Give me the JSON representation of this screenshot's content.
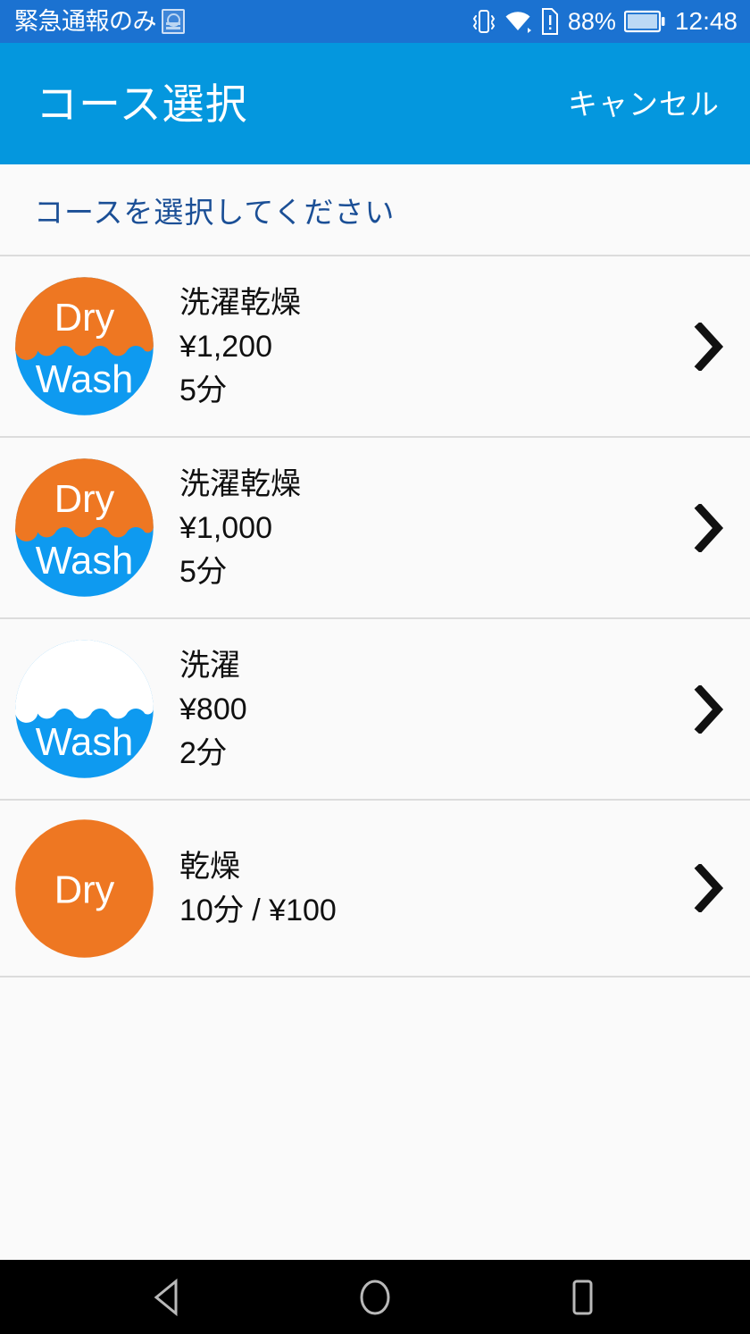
{
  "status_bar": {
    "carrier": "緊急通報のみ",
    "app_badge_icon": "app-badge-icon",
    "vibrate_icon": "vibrate-icon",
    "wifi_icon": "wifi-icon",
    "sim_alert_icon": "sim-alert-icon",
    "battery_percent": "88%",
    "battery_icon": "battery-icon",
    "clock": "12:48",
    "background_color": "#1b72d1",
    "foreground_color": "#ffffff"
  },
  "app_bar": {
    "title": "コース選択",
    "cancel_label": "キャンセル",
    "background_color": "#0497de"
  },
  "instruction": {
    "text": "コースを選択してください",
    "color": "#1b4f96"
  },
  "courses": [
    {
      "icon": "dry-wash-badge-icon",
      "icon_style": "dry-wash",
      "icon_top_label": "Dry",
      "icon_bottom_label": "Wash",
      "name": "洗濯乾燥",
      "price": "¥1,200",
      "duration": "5分",
      "chevron": "chevron-right-icon"
    },
    {
      "icon": "dry-wash-badge-icon",
      "icon_style": "dry-wash",
      "icon_top_label": "Dry",
      "icon_bottom_label": "Wash",
      "name": "洗濯乾燥",
      "price": "¥1,000",
      "duration": "5分",
      "chevron": "chevron-right-icon"
    },
    {
      "icon": "wash-badge-icon",
      "icon_style": "wash",
      "icon_top_label": "",
      "icon_bottom_label": "Wash",
      "name": "洗濯",
      "price": "¥800",
      "duration": "2分",
      "chevron": "chevron-right-icon"
    },
    {
      "icon": "dry-badge-icon",
      "icon_style": "dry",
      "icon_top_label": "",
      "icon_bottom_label": "Dry",
      "name": "乾燥",
      "price": "10分 / ¥100",
      "duration": "",
      "chevron": "chevron-right-icon"
    }
  ],
  "nav_bar": {
    "back_icon": "back-triangle-icon",
    "home_icon": "home-circle-icon",
    "recents_icon": "recents-square-icon",
    "background_color": "#000000"
  },
  "colors": {
    "orange": "#ee7722",
    "blue": "#0e9af0",
    "header_blue": "#0497de",
    "page_background": "#fafafa",
    "divider": "#dcdcdc"
  }
}
